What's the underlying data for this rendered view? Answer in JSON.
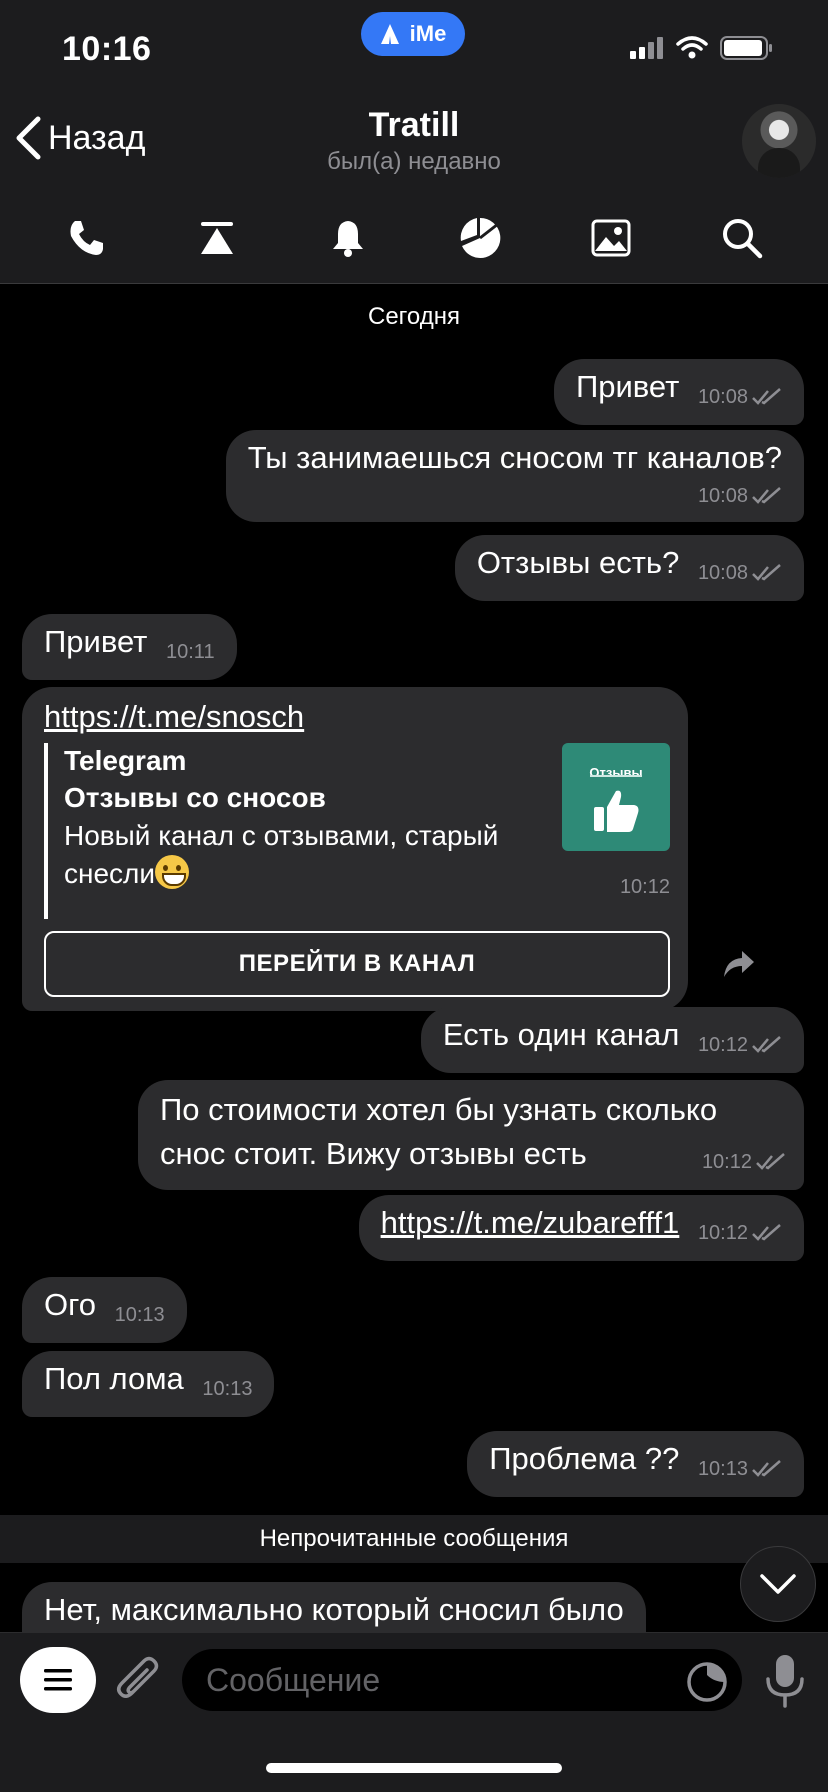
{
  "status_bar": {
    "time": "10:16",
    "badge": "iMe"
  },
  "header": {
    "back_label": "Назад",
    "title": "Tratill",
    "subtitle": "был(а) недавно"
  },
  "toolbar": {
    "icons": [
      "phone-icon",
      "pin-icon",
      "bell-icon",
      "pie-chart-icon",
      "image-icon",
      "search-icon"
    ]
  },
  "chat": {
    "date_separator": "Сегодня",
    "unread_label": "Непрочитанные сообщения",
    "messages": [
      {
        "dir": "out",
        "text": "Привет",
        "time": "10:08"
      },
      {
        "dir": "out",
        "text": "Ты занимаешься сносом тг каналов?",
        "time": "10:08"
      },
      {
        "dir": "out",
        "text": "Отзывы есть?",
        "time": "10:08"
      },
      {
        "dir": "in",
        "text": "Привет",
        "time": "10:11"
      },
      {
        "dir": "in",
        "link": "https://t.me/snosch",
        "preview": {
          "site": "Telegram",
          "title": "Отзывы со сносов",
          "description": "Новый канал с отзывами, старый снесли",
          "thumb_label": "Отзывы"
        },
        "button": "ПЕРЕЙТИ В КАНАЛ",
        "time": "10:12"
      },
      {
        "dir": "out",
        "text": "Есть один канал",
        "time": "10:12"
      },
      {
        "dir": "out",
        "text": "По стоимости хотел бы узнать сколько снос стоит. Вижу отзывы есть",
        "time": "10:12"
      },
      {
        "dir": "out",
        "link": "https://t.me/zubarefff1",
        "time": "10:12"
      },
      {
        "dir": "in",
        "text": "Ого",
        "time": "10:13"
      },
      {
        "dir": "in",
        "text": "Пол лома",
        "time": "10:13"
      },
      {
        "dir": "out",
        "text": "Проблема ??",
        "time": "10:13"
      },
      {
        "dir": "in",
        "text": "Нет, максимально который сносил было",
        "time": ""
      }
    ]
  },
  "input": {
    "placeholder": "Сообщение"
  },
  "colors": {
    "accent": "#3478f6",
    "bubble": "#2c2c2e",
    "bar": "#1c1c1e",
    "thumb": "#2e8a77"
  }
}
